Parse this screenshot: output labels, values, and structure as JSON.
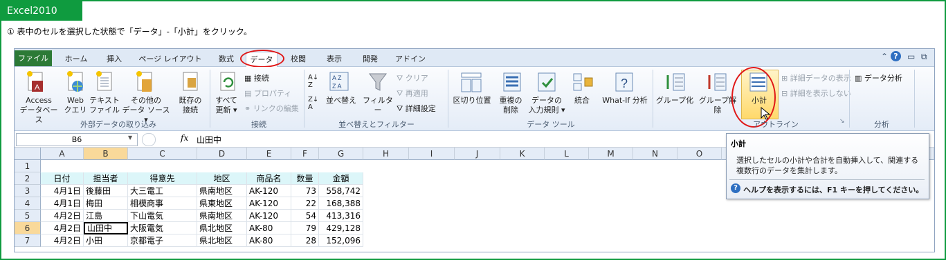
{
  "badge": "Excel2010",
  "instruction": "① 表中のセルを選択した状態で「データ」-「小計」をクリック。",
  "tabs": [
    "ファイル",
    "ホーム",
    "挿入",
    "ページ レイアウト",
    "数式",
    "データ",
    "校閲",
    "表示",
    "開発",
    "アドイン"
  ],
  "active_tab": "データ",
  "ribbon": {
    "external": {
      "access_l1": "Access",
      "access_l2": "データベース",
      "web_l1": "Web",
      "web_l2": "クエリ",
      "text_l1": "テキスト",
      "text_l2": "ファイル",
      "other_l1": "その他の",
      "other_l2": "データ ソース ▾",
      "group": "外部データの取り込み"
    },
    "existing_l1": "既存の",
    "existing_l2": "接続",
    "connections": {
      "refresh_l1": "すべて",
      "refresh_l2": "更新 ▾",
      "connect": "接続",
      "properties": "プロパティ",
      "edit_links": "リンクの編集",
      "group": "接続"
    },
    "sort": {
      "sort": "並べ替え",
      "filter": "フィルター",
      "clear": "クリア",
      "reapply": "再適用",
      "advanced": "詳細設定",
      "group": "並べ替えとフィルター"
    },
    "tools": {
      "text_to_columns": "区切り位置",
      "remove_dup_l1": "重複の",
      "remove_dup_l2": "削除",
      "validation_l1": "データの",
      "validation_l2": "入力規則 ▾",
      "consolidate": "統合",
      "whatif": "What-If 分析",
      "group": "データ ツール"
    },
    "outline": {
      "group_btn": "グループ化",
      "ungroup_btn": "グループ解除",
      "subtotal": "小計",
      "show_detail": "詳細データの表示",
      "hide_detail": "詳細を表示しない",
      "group": "アウトライン"
    },
    "analysis": {
      "data_analysis": "データ分析",
      "group": "分析"
    }
  },
  "formula_bar": {
    "name_box": "B6",
    "fx": "fx",
    "content": "山田中"
  },
  "columns": [
    "A",
    "B",
    "C",
    "D",
    "E",
    "F",
    "G",
    "H",
    "I",
    "J",
    "K",
    "L",
    "M",
    "N",
    "O"
  ],
  "rows": [
    "1",
    "2",
    "3",
    "4",
    "5",
    "6",
    "7"
  ],
  "table_header": [
    "日付",
    "担当者",
    "得意先",
    "地区",
    "商品名",
    "数量",
    "金額"
  ],
  "table_rows": [
    [
      "4月1日",
      "後藤田",
      "大三電工",
      "県南地区",
      "AK-120",
      "73",
      "558,742"
    ],
    [
      "4月1日",
      "梅田",
      "相模商事",
      "県東地区",
      "AK-120",
      "22",
      "168,388"
    ],
    [
      "4月2日",
      "江島",
      "下山電気",
      "県南地区",
      "AK-120",
      "54",
      "413,316"
    ],
    [
      "4月2日",
      "山田中",
      "大阪電気",
      "県北地区",
      "AK-80",
      "79",
      "429,128"
    ],
    [
      "4月2日",
      "小田",
      "京都電子",
      "県北地区",
      "AK-80",
      "28",
      "152,096"
    ]
  ],
  "tooltip": {
    "title": "小計",
    "body": "選択したセルの小計や合計を自動挿入して、関連する複数行のデータを集計します。",
    "help": "ヘルプを表示するには、F1 キーを押してください。"
  },
  "colors": {
    "frame": "#0f9b3f",
    "highlight": "#e01818",
    "header_fill": "#dcf6f9",
    "file_tab": "#2c7a36"
  }
}
